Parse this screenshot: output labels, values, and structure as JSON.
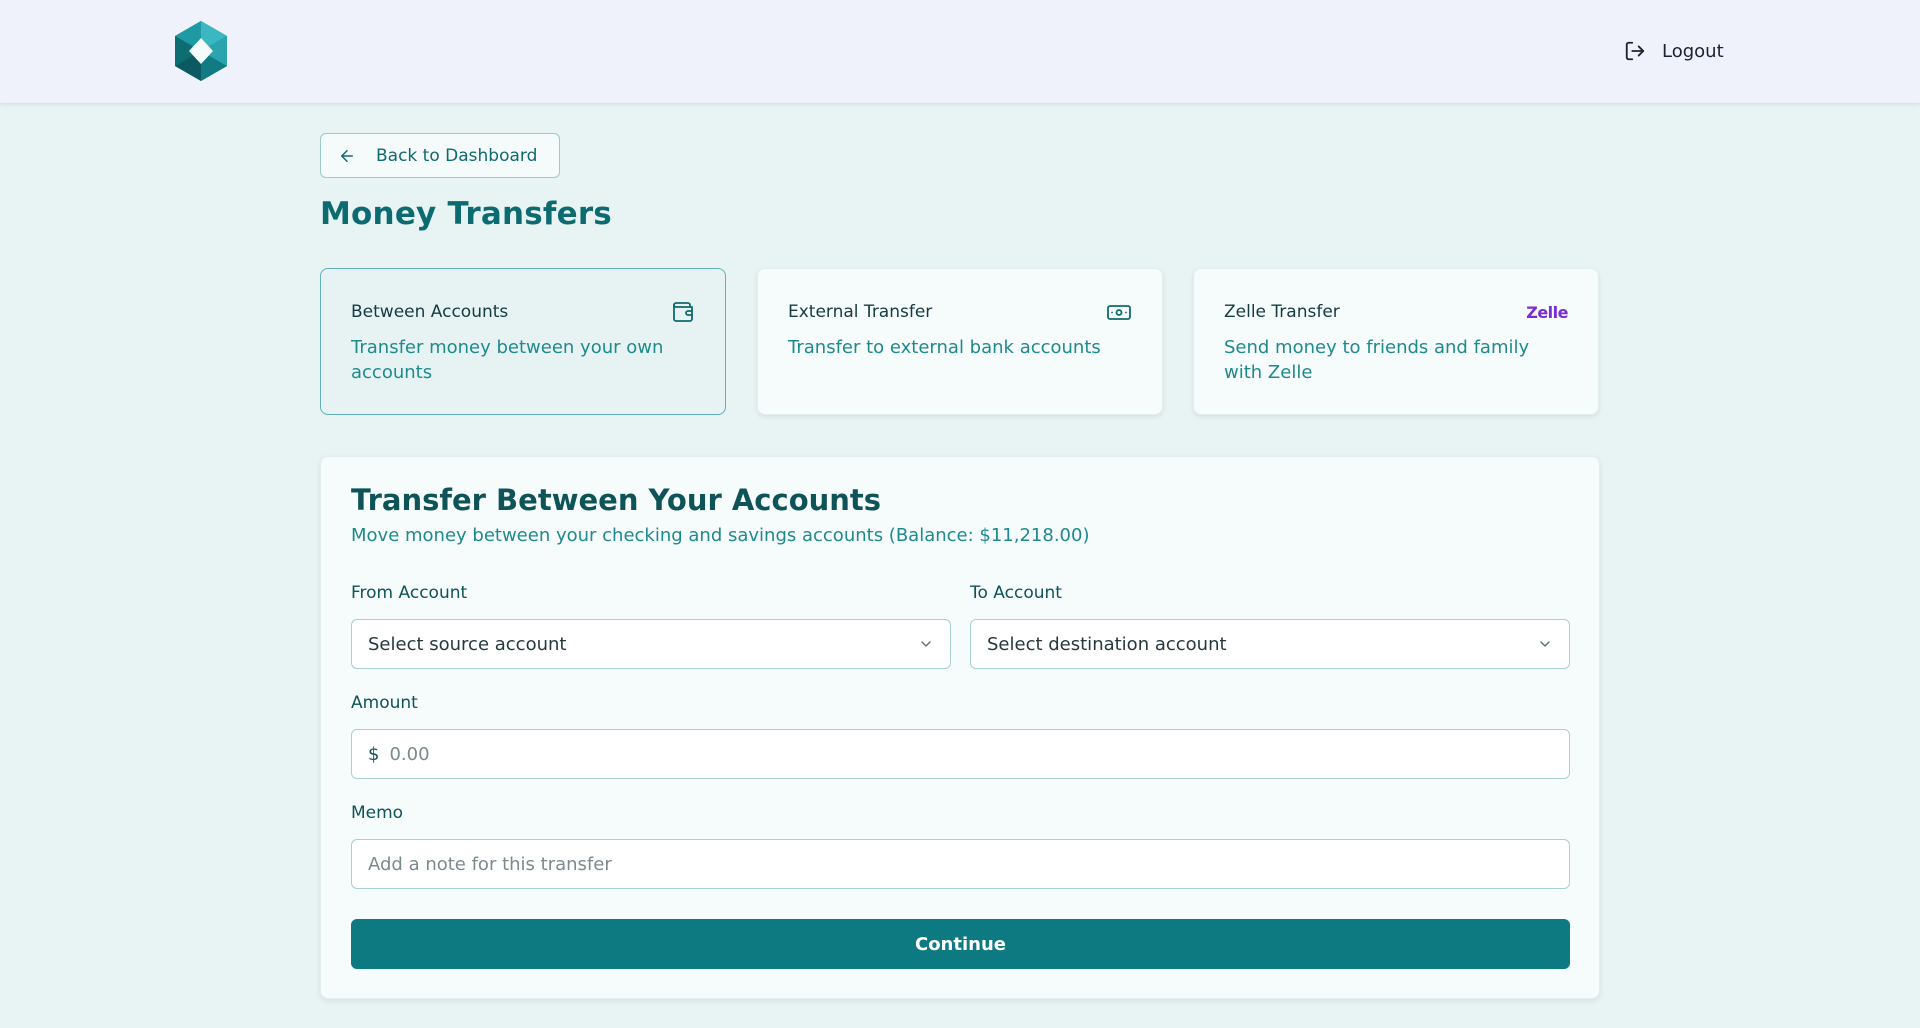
{
  "header": {
    "logo_icon": "hexagon-logo-icon",
    "logout": {
      "label": "Logout",
      "icon": "logout-icon"
    }
  },
  "back_button": {
    "label": "Back to Dashboard",
    "icon": "arrow-left-icon"
  },
  "page_title": "Money Transfers",
  "transfer_types": [
    {
      "title": "Between Accounts",
      "description": "Transfer money between your own accounts",
      "icon": "wallet-icon",
      "selected": true
    },
    {
      "title": "External Transfer",
      "description": "Transfer to external bank accounts",
      "icon": "banknote-icon",
      "selected": false
    },
    {
      "title": "Zelle Transfer",
      "description": "Send money to friends and family with Zelle",
      "icon": "zelle-icon",
      "icon_text": "Zelle",
      "selected": false
    }
  ],
  "form": {
    "title": "Transfer Between Your Accounts",
    "subtitle": "Move money between your checking and savings accounts (Balance: $11,218.00)",
    "from_account": {
      "label": "From Account",
      "value": "Select source account"
    },
    "to_account": {
      "label": "To Account",
      "value": "Select destination account"
    },
    "amount": {
      "label": "Amount",
      "prefix": "$",
      "placeholder": "0.00"
    },
    "memo": {
      "label": "Memo",
      "placeholder": "Add a note for this transfer"
    },
    "continue_label": "Continue"
  },
  "colors": {
    "primary": "#0c7a80",
    "background": "#e8f3f3",
    "header_bg": "#f0f2fb",
    "zelle_purple": "#7a2bd1"
  }
}
